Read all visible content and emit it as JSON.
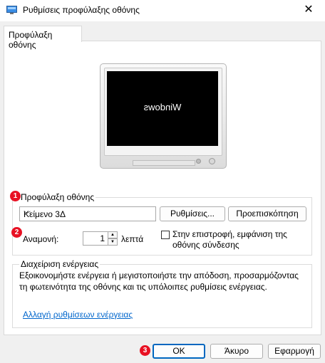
{
  "window": {
    "title": "Ρυθμίσεις προφύλαξης οθόνης",
    "close_glyph": "✕"
  },
  "tab": {
    "label": "Προφύλαξη οθόνης"
  },
  "preview": {
    "screen_text": "Windows"
  },
  "screensaver": {
    "group_label": "Προφύλαξη οθόνης",
    "selected": "Κείμενο 3Δ",
    "settings_button": "Ρυθμίσεις...",
    "preview_button": "Προεπισκόπηση",
    "wait_label": "Αναμονή:",
    "wait_value": "1",
    "wait_unit": "λεπτά",
    "resume_line1": "Στην επιστροφή, εμφάνιση της",
    "resume_line2": "οθόνης σύνδεσης",
    "resume_checked": false
  },
  "power": {
    "group_label": "Διαχείριση ενέργειας",
    "desc_line1": "Εξοικονομήστε ενέργεια ή μεγιστοποιήστε την απόδοση, προσαρμόζοντας",
    "desc_line2": "τη φωτεινότητα της οθόνης και τις υπόλοιπες ρυθμίσεις ενέργειας.",
    "link": "Αλλαγή ρυθμίσεων ενέργειας"
  },
  "buttons": {
    "ok": "OK",
    "cancel": "Άκυρο",
    "apply": "Εφαρμογή"
  },
  "badges": {
    "b1": "1",
    "b2": "2",
    "b3": "3"
  },
  "colors": {
    "accent": "#0067c0",
    "badge": "#e81123",
    "link": "#0066cc"
  }
}
